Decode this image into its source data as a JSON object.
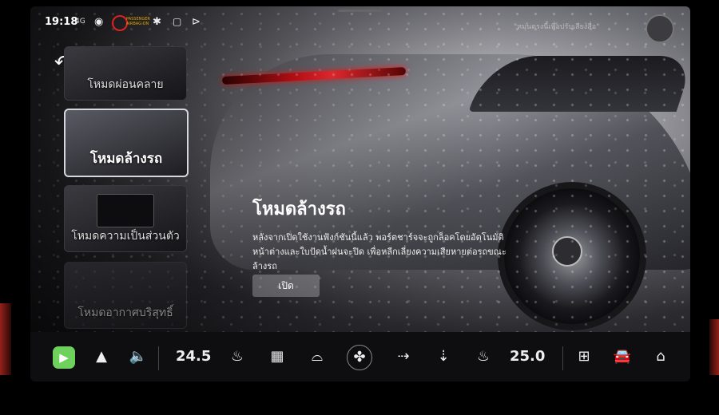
{
  "status": {
    "time": "19:18",
    "signal": "4G",
    "airbag_text": "PASSENGER AIRBAG ON",
    "notice": "\"หมุนตรงนี้เพื่อปรับเสียงสื่อ\""
  },
  "modes": [
    {
      "label": "โหมดผ่อนคลาย",
      "state": "normal"
    },
    {
      "label": "โหมดล้างรถ",
      "state": "active"
    },
    {
      "label": "โหมดความเป็นส่วนตัว",
      "state": "normal"
    },
    {
      "label": "โหมดอากาศบริสุทธิ์",
      "state": "faded"
    }
  ],
  "detail": {
    "title": "โหมดล้างรถ",
    "description": "หลังจากเปิดใช้งานฟังก์ชันนี้แล้ว พอร์ตชาร์จจะถูกล็อคโดยอัตโนมัติ หน้าต่างและใบปัดน้ำฝนจะปิด เพื่อหลีกเลี่ยงความเสียหายต่อรถขณะล้างรถ",
    "button_label": "เปิด"
  },
  "dock": {
    "temp_left": "24.5",
    "temp_right": "25.0",
    "icons": [
      "carplay-icon",
      "android-auto-icon",
      "volume-icon",
      "seat-heat-icon",
      "defrost-rear-icon",
      "defrost-front-icon",
      "fan-icon",
      "airflow-face-icon",
      "airflow-feet-icon",
      "seat-heat-right-icon",
      "apps-grid-icon",
      "car-icon",
      "home-icon"
    ]
  },
  "colors": {
    "taillight": "#e0121a",
    "carplay": "#6ed15c",
    "airbag_warning": "#e02020"
  }
}
